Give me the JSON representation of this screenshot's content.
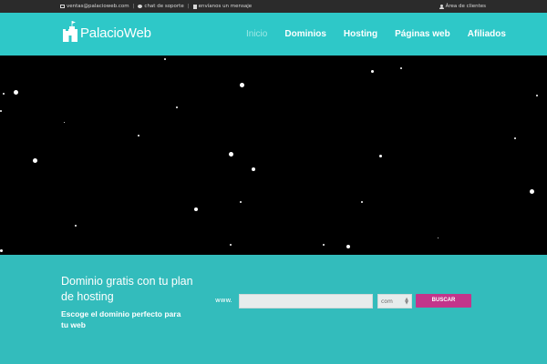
{
  "topbar": {
    "email": "ventas@palacioweb.com",
    "chat": "chat de soporte",
    "message": "envíanos un mensaje",
    "client_area": "Área de clientes"
  },
  "header": {
    "logo_text": "PalacioWeb",
    "nav": [
      "Inicio",
      "Dominios",
      "Hosting",
      "Páginas web",
      "Afiliados"
    ]
  },
  "promo": {
    "title": "Dominio gratis con tu plan de hosting",
    "subtitle": "Escoge el dominio perfecto para tu web",
    "www_label": "www.",
    "domain_value": "",
    "tld_value": "com",
    "button_label": "BUSCAR"
  },
  "colors": {
    "topbar": "#2b2b2b",
    "navbar": "#2ec8c8",
    "promo": "#33bcbc",
    "button": "#c3358b"
  }
}
